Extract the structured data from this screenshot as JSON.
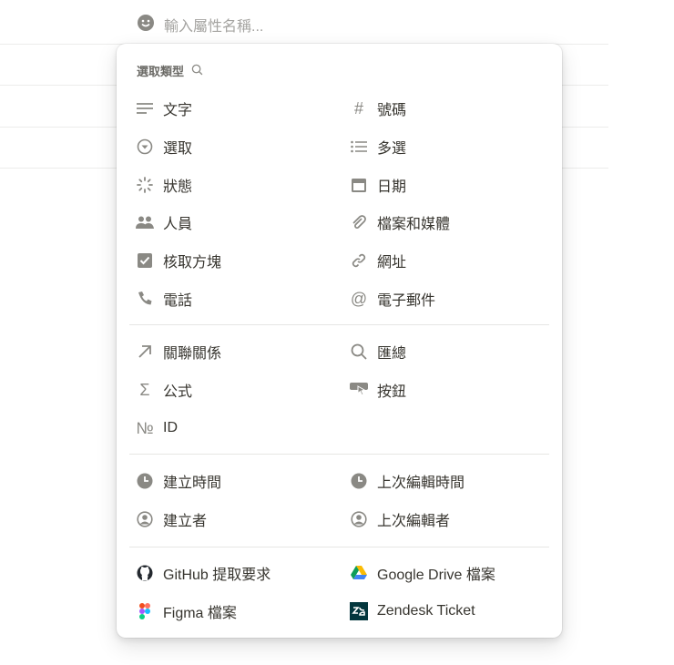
{
  "input": {
    "placeholder": "輸入屬性名稱..."
  },
  "menu": {
    "header": "選取類型",
    "items": [
      {
        "label": "文字",
        "icon": "text-lines-icon",
        "col": 0,
        "row": 0
      },
      {
        "label": "號碼",
        "icon": "hash-icon",
        "col": 1,
        "row": 0
      },
      {
        "label": "選取",
        "icon": "select-icon",
        "col": 0,
        "row": 1
      },
      {
        "label": "多選",
        "icon": "list-icon",
        "col": 1,
        "row": 1
      },
      {
        "label": "狀態",
        "icon": "status-spinner-icon",
        "col": 0,
        "row": 2
      },
      {
        "label": "日期",
        "icon": "calendar-icon",
        "col": 1,
        "row": 2
      },
      {
        "label": "人員",
        "icon": "people-icon",
        "col": 0,
        "row": 3
      },
      {
        "label": "檔案和媒體",
        "icon": "paperclip-icon",
        "col": 1,
        "row": 3
      },
      {
        "label": "核取方塊",
        "icon": "checkbox-icon",
        "col": 0,
        "row": 4
      },
      {
        "label": "網址",
        "icon": "link-icon",
        "col": 1,
        "row": 4
      },
      {
        "label": "電話",
        "icon": "phone-icon",
        "col": 0,
        "row": 5
      },
      {
        "label": "電子郵件",
        "icon": "at-icon",
        "col": 1,
        "row": 5
      },
      {
        "label": "關聯關係",
        "icon": "arrow-up-right-icon",
        "col": 0,
        "row": 6
      },
      {
        "label": "匯總",
        "icon": "search-icon",
        "col": 1,
        "row": 6
      },
      {
        "label": "公式",
        "icon": "sigma-icon",
        "col": 0,
        "row": 7
      },
      {
        "label": "按鈕",
        "icon": "button-cursor-icon",
        "col": 1,
        "row": 7
      },
      {
        "label": "ID",
        "icon": "numero-icon",
        "col": 0,
        "row": 8
      },
      {
        "label": "建立時間",
        "icon": "clock-icon",
        "col": 0,
        "row": 9
      },
      {
        "label": "上次編輯時間",
        "icon": "clock-icon",
        "col": 1,
        "row": 9
      },
      {
        "label": "建立者",
        "icon": "user-circle-icon",
        "col": 0,
        "row": 10
      },
      {
        "label": "上次編輯者",
        "icon": "user-circle-icon",
        "col": 1,
        "row": 10
      },
      {
        "label": "GitHub 提取要求",
        "icon": "github-icon",
        "col": 0,
        "row": 11
      },
      {
        "label": "Google Drive 檔案",
        "icon": "google-drive-icon",
        "col": 1,
        "row": 11
      },
      {
        "label": "Figma 檔案",
        "icon": "figma-icon",
        "col": 0,
        "row": 12
      },
      {
        "label": "Zendesk Ticket",
        "icon": "zendesk-icon",
        "col": 1,
        "row": 12
      }
    ]
  }
}
